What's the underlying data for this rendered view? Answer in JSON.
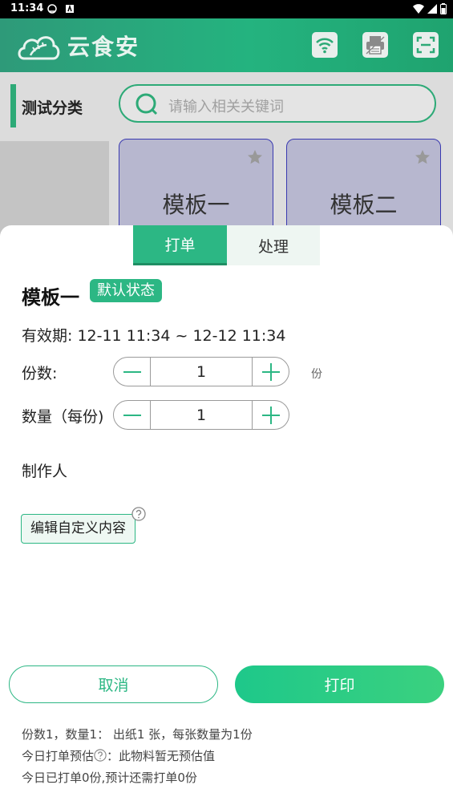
{
  "status_bar": {
    "time": "11:34"
  },
  "app": {
    "title": "云食安",
    "header_icons": [
      "wifi-icon",
      "printer-icon",
      "scan-icon"
    ]
  },
  "category": {
    "label": "测试分类"
  },
  "search": {
    "placeholder": "请输入相关关键词"
  },
  "templates": [
    {
      "name": "模板一",
      "favorite": false
    },
    {
      "name": "模板二",
      "favorite": false
    }
  ],
  "sheet": {
    "tabs": [
      {
        "label": "打单",
        "active": true
      },
      {
        "label": "处理",
        "active": false
      }
    ],
    "template_name": "模板一",
    "status_badge": "默认状态",
    "validity": "有效期: 12-11 11:34 ~ 12-12 11:34",
    "copies": {
      "label": "份数:",
      "value": "1",
      "unit": "份"
    },
    "quantity": {
      "label": "数量（每份)",
      "value": "1"
    },
    "maker_label": "制作人",
    "edit_custom_label": "编辑自定义内容",
    "cancel_label": "取消",
    "print_label": "打印",
    "notes": {
      "line1": "份数1，数量1： 出纸1 张，每张数量为1份",
      "line2_prefix": "今日打单预估",
      "line2_suffix": "：此物料暂无预估值",
      "line3": "今日已打单0份,预计还需打单0份"
    }
  },
  "colors": {
    "accent": "#2cb784",
    "header_start": "#2e9a79",
    "header_end": "#1fa36f",
    "template_card": "#b7b7cf",
    "template_border": "#3a3ab0"
  }
}
